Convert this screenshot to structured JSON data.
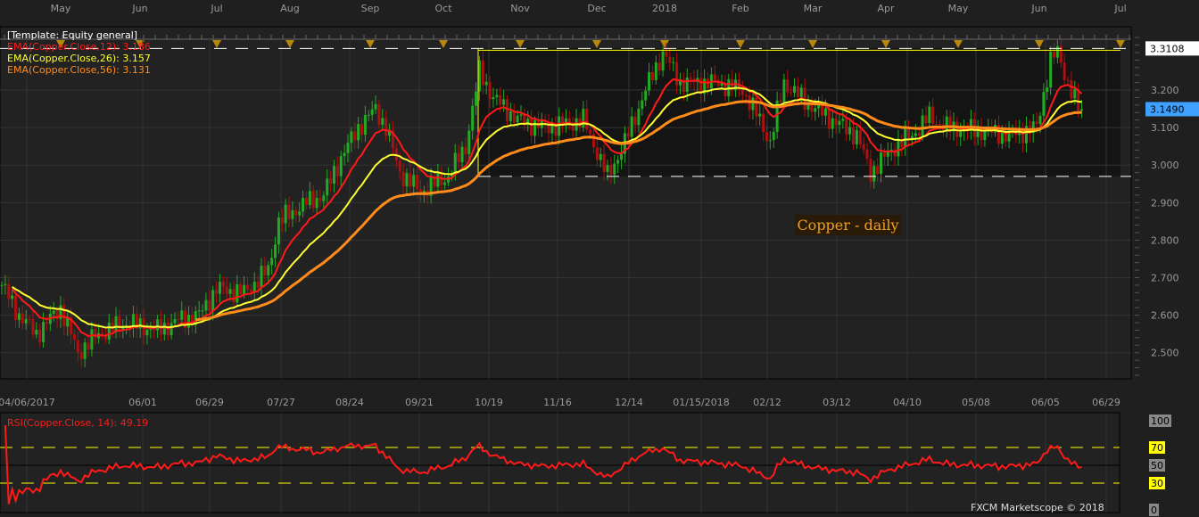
{
  "chart_data": {
    "type": "candlestick",
    "title": "Copper - daily",
    "template_label": "[Template: Equity general]",
    "legend": [
      {
        "label": "EMA(Copper.Close,12): 3.186",
        "period": 12,
        "color": "#ff1a1a"
      },
      {
        "label": "EMA(Copper.Close,26): 3.157",
        "period": 26,
        "color": "#ffff33"
      },
      {
        "label": "EMA(Copper.Close,56): 3.131",
        "period": 56,
        "color": "#ff8c1a"
      }
    ],
    "months": [
      "May",
      "Jun",
      "Jul",
      "Aug",
      "Sep",
      "Oct",
      "Nov",
      "Dec",
      "2018",
      "Feb",
      "Mar",
      "Apr",
      "May",
      "Jun",
      "Jul"
    ],
    "date_ticks": [
      "04/06/2017",
      "06/01",
      "06/29",
      "07/27",
      "08/24",
      "09/21",
      "10/19",
      "11/16",
      "12/14",
      "01/15/2018",
      "02/12",
      "03/12",
      "04/10",
      "05/08",
      "06/05",
      "06/29"
    ],
    "y_ticks": [
      "2.500",
      "2.600",
      "2.700",
      "2.800",
      "2.900",
      "3.000",
      "3.100",
      "3.200"
    ],
    "ylim": [
      2.42,
      3.37
    ],
    "high_marker": "3.3108",
    "last_price": "3.1490",
    "range_high": 3.3108,
    "range_low": 2.97,
    "close_keypoints": [
      [
        0,
        2.68
      ],
      [
        5,
        2.6
      ],
      [
        10,
        2.55
      ],
      [
        17,
        2.62
      ],
      [
        22,
        2.5
      ],
      [
        28,
        2.55
      ],
      [
        36,
        2.58
      ],
      [
        45,
        2.56
      ],
      [
        52,
        2.59
      ],
      [
        57,
        2.6
      ],
      [
        62,
        2.67
      ],
      [
        70,
        2.66
      ],
      [
        77,
        2.72
      ],
      [
        80,
        2.85
      ],
      [
        88,
        2.9
      ],
      [
        93,
        2.92
      ],
      [
        98,
        3.02
      ],
      [
        103,
        3.1
      ],
      [
        108,
        3.15
      ],
      [
        111,
        3.1
      ],
      [
        115,
        2.98
      ],
      [
        121,
        2.93
      ],
      [
        129,
        2.97
      ],
      [
        134,
        3.05
      ],
      [
        138,
        3.25
      ],
      [
        142,
        3.18
      ],
      [
        149,
        3.12
      ],
      [
        157,
        3.1
      ],
      [
        168,
        3.12
      ],
      [
        175,
        2.97
      ],
      [
        180,
        3.06
      ],
      [
        186,
        3.2
      ],
      [
        191,
        3.3
      ],
      [
        196,
        3.22
      ],
      [
        206,
        3.22
      ],
      [
        214,
        3.2
      ],
      [
        219,
        3.12
      ],
      [
        222,
        3.06
      ],
      [
        226,
        3.22
      ],
      [
        232,
        3.17
      ],
      [
        240,
        3.12
      ],
      [
        247,
        3.08
      ],
      [
        251,
        2.98
      ],
      [
        258,
        3.05
      ],
      [
        263,
        3.08
      ],
      [
        268,
        3.13
      ],
      [
        273,
        3.1
      ],
      [
        284,
        3.09
      ],
      [
        291,
        3.08
      ],
      [
        299,
        3.1
      ],
      [
        303,
        3.28
      ],
      [
        305,
        3.3
      ],
      [
        308,
        3.22
      ],
      [
        311,
        3.15
      ],
      [
        312,
        3.149
      ]
    ],
    "rsi": {
      "label": "RSI(Copper.Close, 14): 49.19",
      "period": 14,
      "levels": [
        "100",
        "70",
        "50",
        "30",
        "0"
      ]
    },
    "copyright": "FXCM Marketscope © 2018"
  }
}
